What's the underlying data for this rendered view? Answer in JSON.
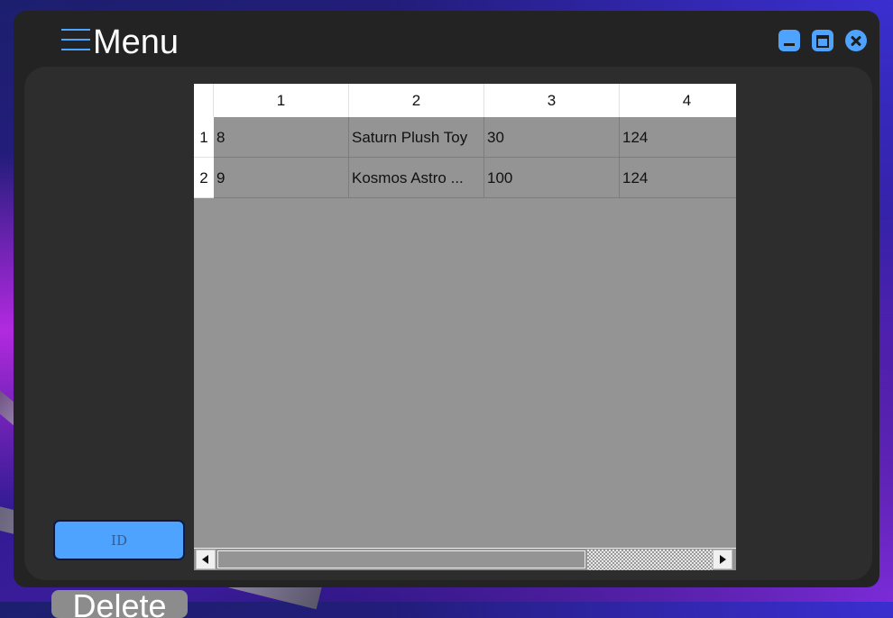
{
  "window": {
    "title": "Menu",
    "icons": {
      "menu": "hamburger-icon",
      "minimize": "minimize-icon",
      "maximize": "maximize-icon",
      "close": "close-icon"
    },
    "accent_color": "#4ea3ff"
  },
  "sidebar": {
    "id_input": {
      "placeholder": "ID",
      "value": ""
    },
    "delete_label": "Delete"
  },
  "table": {
    "columns": [
      "1",
      "2",
      "3",
      "4"
    ],
    "rows": [
      {
        "header": "1",
        "cells": [
          "8",
          "Saturn Plush Toy",
          "30",
          "124"
        ]
      },
      {
        "header": "2",
        "cells": [
          "9",
          "Kosmos Astro ...",
          "100",
          "124"
        ]
      }
    ]
  }
}
